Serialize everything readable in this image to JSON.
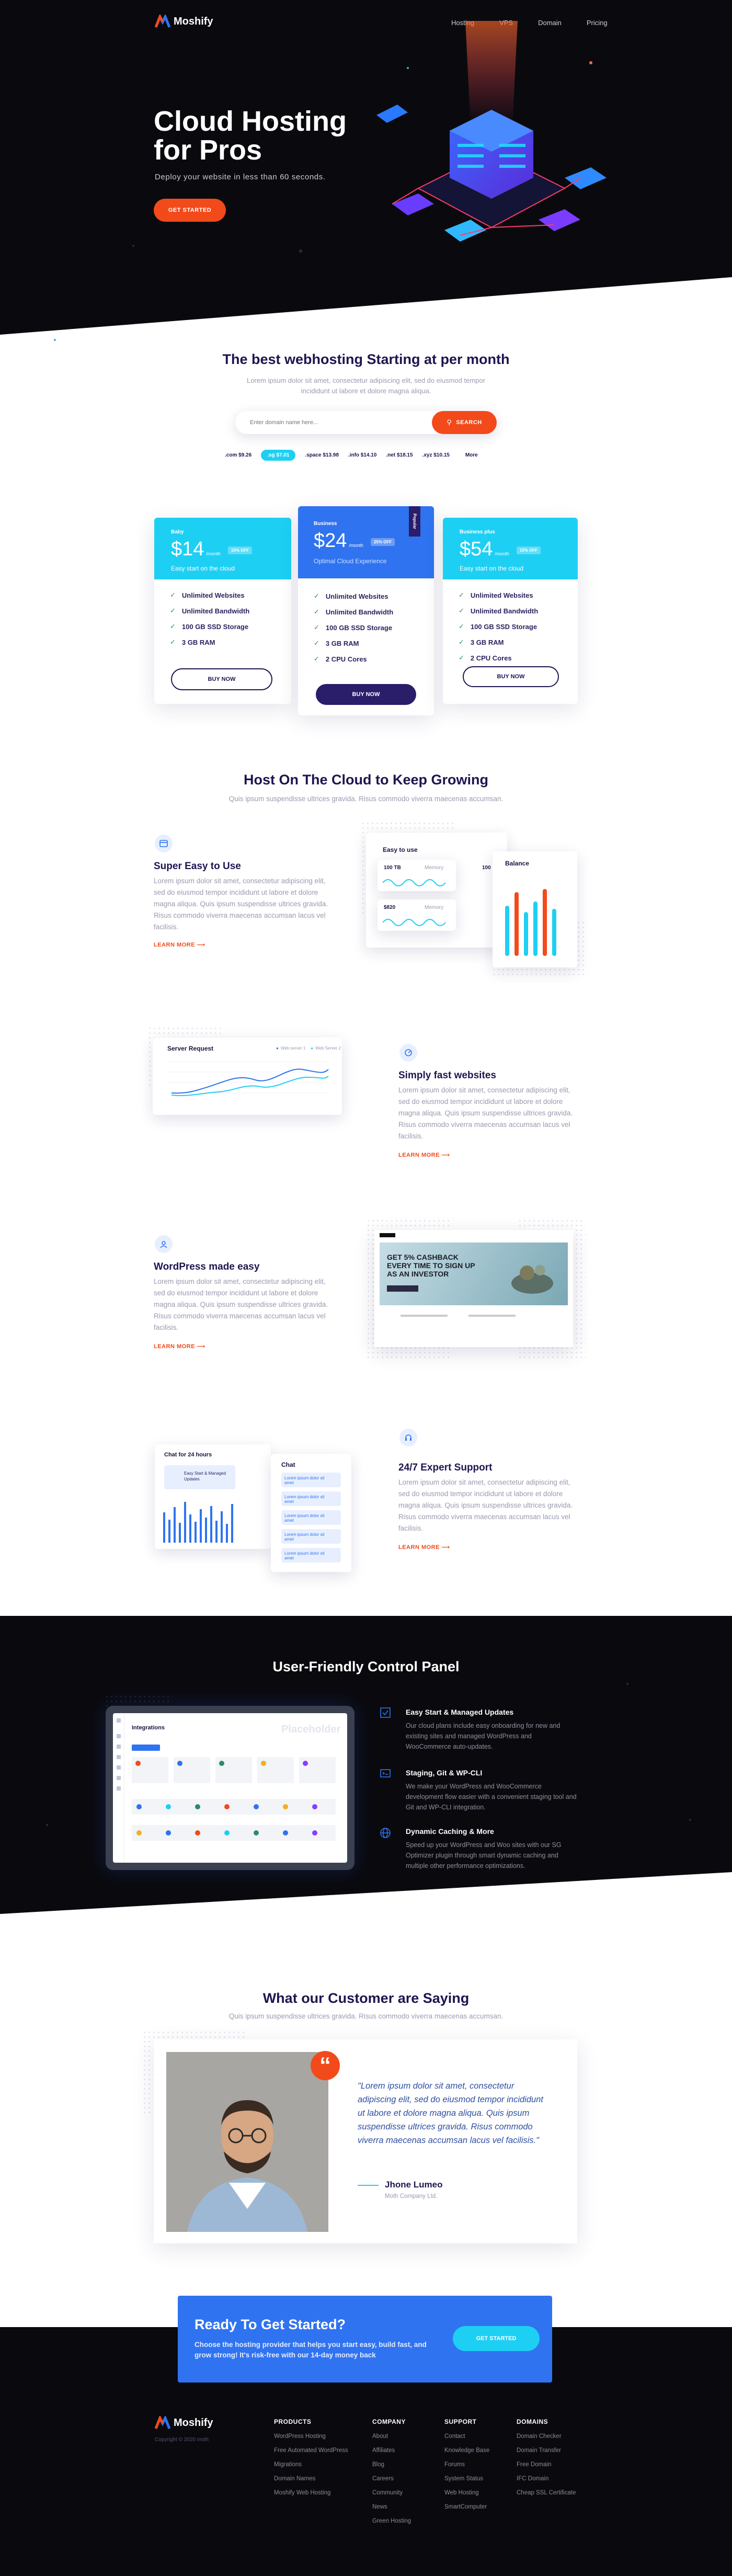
{
  "brand": {
    "name": "Moshify",
    "accent": "#f24a1a",
    "cyan": "#1ecff4",
    "blue": "#2f73f0",
    "navy": "#1e1550"
  },
  "nav": {
    "items": [
      "Hosting",
      "VPS",
      "Domain",
      "Pricing"
    ]
  },
  "hero": {
    "title_line1": "Cloud Hosting",
    "title_line2": "for Pros",
    "subtitle": "Deploy your website in less than 60 seconds.",
    "cta": "GET STARTED"
  },
  "domain_search": {
    "title": "The best webhosting Starting at per month",
    "desc_line1": "Lorem ipsum dolor sit amet, consectetur adipiscing elit, sed do eiusmod tempor",
    "desc_line2": "incididunt ut labore et dolore magna aliqua.",
    "placeholder": "Enter domain name here...",
    "search_btn": "SEARCH",
    "tlds": [
      {
        "label": ".com $9.26"
      },
      {
        "label": ".sg $7.01"
      },
      {
        "label": ".space $13.98"
      },
      {
        "label": ".info $14.10"
      },
      {
        "label": ".net $18.15"
      },
      {
        "label": ".xyz $10.15"
      },
      {
        "label": "More"
      }
    ]
  },
  "pricing": {
    "plans": [
      {
        "name": "Baby",
        "price": "$14",
        "per": "/month",
        "badge": "15% OFF",
        "tagline": "Easy start on the cloud",
        "features": [
          "Unlimited Websites",
          "Unlimited Bandwidth",
          "100 GB SSD Storage",
          "3 GB RAM"
        ],
        "cta": "BUY NOW"
      },
      {
        "name": "Business",
        "price": "$24",
        "per": "/month",
        "badge": "25% OFF",
        "ribbon": "Popular",
        "tagline": "Optimal Cloud Experience",
        "features": [
          "Unlimited Websites",
          "Unlimited Bandwidth",
          "100 GB SSD Storage",
          "3 GB RAM",
          "2 CPU Cores"
        ],
        "cta": "BUY NOW"
      },
      {
        "name": "Business plus",
        "price": "$54",
        "per": "/month",
        "badge": "15% OFF",
        "tagline": "Easy start on the cloud",
        "features": [
          "Unlimited Websites",
          "Unlimited Bandwidth",
          "100 GB SSD Storage",
          "3 GB RAM",
          "2 CPU Cores"
        ],
        "cta": "BUY NOW"
      }
    ]
  },
  "growing": {
    "title": "Host On The Cloud to Keep Growing",
    "subtitle": "Quis ipsum suspendisse ultrices gravida. Risus commodo viverra maecenas accumsan."
  },
  "features": [
    {
      "title": "Super Easy to Use",
      "body": "Lorem ipsum dolor sit amet, consectetur adipiscing elit, sed do eiusmod tempor incididunt ut labore et dolore magna aliqua. Quis ipsum suspendisse ultrices gravida. Risus commodo viverra maecenas accumsan lacus vel facilisis.",
      "link": "LEARN MORE"
    },
    {
      "title": "Simply fast websites",
      "body": "Lorem ipsum dolor sit amet, consectetur adipiscing elit, sed do eiusmod tempor incididunt ut labore et dolore magna aliqua. Quis ipsum suspendisse ultrices gravida. Risus commodo viverra maecenas accumsan lacus vel facilisis.",
      "link": "LEARN MORE"
    },
    {
      "title": "WordPress made easy",
      "body": "Lorem ipsum dolor sit amet, consectetur adipiscing elit, sed do eiusmod tempor incididunt ut labore et dolore magna aliqua. Quis ipsum suspendisse ultrices gravida. Risus commodo viverra maecenas accumsan lacus vel facilisis.",
      "link": "LEARN MORE"
    },
    {
      "title": "24/7 Expert Support",
      "body": "Lorem ipsum dolor sit amet, consectetur adipiscing elit, sed do eiusmod tempor incididunt ut labore et dolore magna aliqua. Quis ipsum suspendisse ultrices gravida. Risus commodo viverra maecenas accumsan lacus vel facilisis.",
      "link": "LEARN MORE"
    }
  ],
  "widgets": {
    "easy_to_use": "Easy to use",
    "memory": "Memory",
    "val1": "100 TB",
    "val2": "$820",
    "val3": "100",
    "balance": "Balance",
    "server_request": "Server Request",
    "legend1": "Web server 1",
    "legend2": "Web Server 2",
    "chat_title": "Chat for 24 hours",
    "chat_label": "Chat",
    "chat_card": "Easy Start & Managed Updates",
    "chat_msg": "Lorem ipsum dolor sit amet"
  },
  "wp_mock": {
    "headline1": "GET 5% CASHBACK",
    "headline2": "EVERY TIME TO SIGN UP",
    "headline3": "AS AN INVESTOR"
  },
  "control_panel": {
    "title": "User-Friendly Control Panel",
    "mock_title": "Integrations",
    "placeholder": "Placeholder",
    "items": [
      {
        "title": "Easy Start & Managed Updates",
        "body": "Our cloud plans include easy onboarding for new and existing sites and managed WordPress and WooCommerce auto-updates."
      },
      {
        "title": "Staging, Git & WP-CLI",
        "body": "We make your WordPress and WooCommerce development flow easier with a convenient staging tool and Git and WP-CLI integration."
      },
      {
        "title": "Dynamic Caching & More",
        "body": "Speed up your WordPress and Woo sites with our SG Optimizer plugin through smart dynamic caching and multiple other performance optimizations."
      }
    ]
  },
  "testimonial": {
    "title": "What our Customer are Saying",
    "subtitle": "Quis ipsum suspendisse ultrices gravida. Risus commodo viverra maecenas accumsan.",
    "quote": "\"Lorem ipsum dolor sit amet, consectetur adipiscing elit, sed do eiusmod tempor incididunt ut labore et dolore magna aliqua. Quis ipsum suspendisse ultrices gravida. Risus commodo viverra maecenas accumsan lacus vel facilisis.\"",
    "name": "Jhone Lumeo",
    "company": "Moth Company Ltd."
  },
  "cta_banner": {
    "title": "Ready To Get Started?",
    "body": "Choose the hosting provider that helps you start easy, build fast, and grow strong! It's risk-free with our 14-day money back",
    "button": "GET STARTED"
  },
  "footer": {
    "copyright": "Copyright © 2020 moth",
    "columns": [
      {
        "heading": "PRODUCTS",
        "links": [
          "WordPress Hosting",
          "Free Automated WordPress",
          "Migrations",
          "Domain Names",
          "Moshify Web Hosting"
        ]
      },
      {
        "heading": "COMPANY",
        "links": [
          "About",
          "Affiliates",
          "Blog",
          "Careers",
          "Community",
          "News",
          "Green Hosting"
        ]
      },
      {
        "heading": "SUPPORT",
        "links": [
          "Contact",
          "Knowledge Base",
          "Forums",
          "System Status",
          "Web Hosting",
          "SmartComputer"
        ]
      },
      {
        "heading": "DOMAINS",
        "links": [
          "Domain Checker",
          "Domain Transfer",
          "Free Domain",
          "IFC Domain",
          "Cheap SSL Certificate"
        ]
      }
    ]
  }
}
